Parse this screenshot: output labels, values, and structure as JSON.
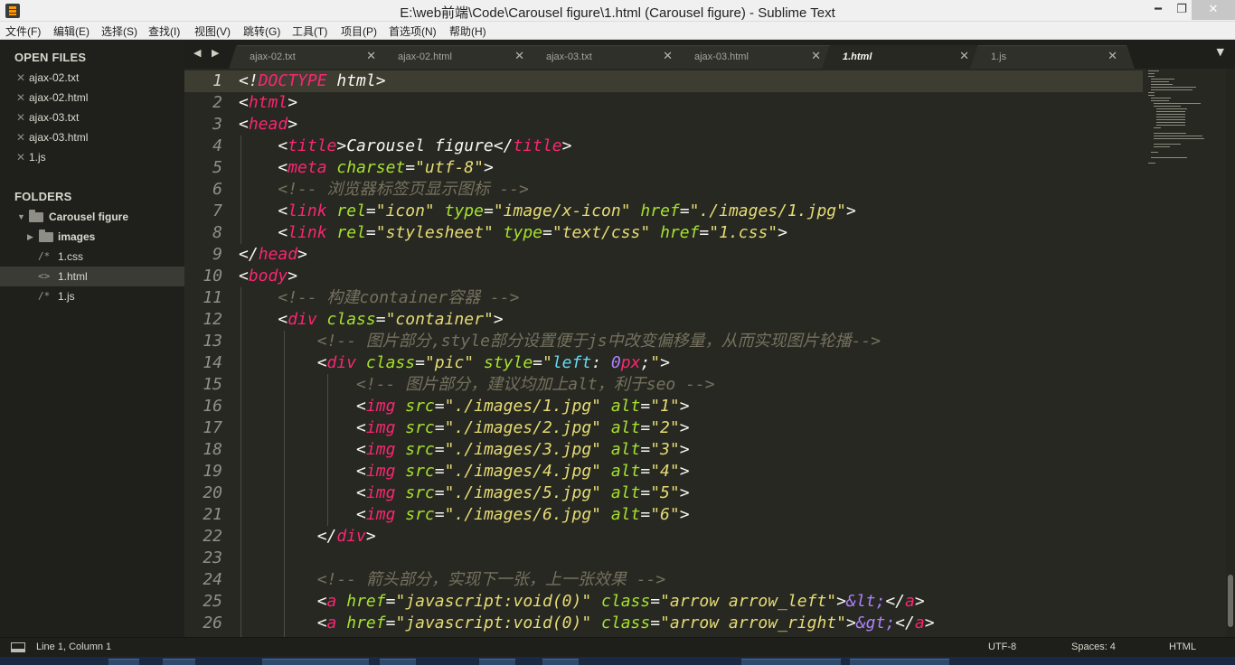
{
  "window": {
    "title": "E:\\web前端\\Code\\Carousel figure\\1.html (Carousel figure) - Sublime Text",
    "min": "━",
    "max": "❐",
    "close": "✕"
  },
  "menu": [
    "文件(F)",
    "编辑(E)",
    "选择(S)",
    "查找(I)",
    "视图(V)",
    "跳转(G)",
    "工具(T)",
    "项目(P)",
    "首选项(N)",
    "帮助(H)"
  ],
  "sidebar": {
    "open_files_label": "OPEN FILES",
    "open_files": [
      "ajax-02.txt",
      "ajax-02.html",
      "ajax-03.txt",
      "ajax-03.html",
      "1.js"
    ],
    "folders_label": "FOLDERS",
    "folders": {
      "root": "Carousel figure",
      "items": [
        {
          "type": "folder",
          "label": "images"
        },
        {
          "type": "file",
          "icon": "/*",
          "label": "1.css"
        },
        {
          "type": "file",
          "icon": "<>",
          "label": "1.html"
        },
        {
          "type": "file",
          "icon": "/*",
          "label": "1.js"
        }
      ]
    }
  },
  "tabs": [
    {
      "label": "ajax-02.txt"
    },
    {
      "label": "ajax-02.html"
    },
    {
      "label": "ajax-03.txt"
    },
    {
      "label": "ajax-03.html"
    },
    {
      "label": "1.html",
      "active": true
    },
    {
      "label": "1.js"
    }
  ],
  "tab_nav": "◀ ▶",
  "tab_close": "✕",
  "tab_dropdown": "▼",
  "editor": {
    "line_numbers": [
      "1",
      "2",
      "3",
      "4",
      "5",
      "6",
      "7",
      "8",
      "9",
      "10",
      "11",
      "12",
      "13",
      "14",
      "15",
      "16",
      "17",
      "18",
      "19",
      "20",
      "21",
      "22",
      "23",
      "24",
      "25",
      "26"
    ],
    "current_line": 1,
    "code_lines": [
      "<!DOCTYPE html>",
      "<html>",
      "<head>",
      "    <title>Carousel figure</title>",
      "    <meta charset=\"utf-8\">",
      "    <!-- 浏览器标签页显示图标 -->",
      "    <link rel=\"icon\" type=\"image/x-icon\" href=\"./images/1.jpg\">",
      "    <link rel=\"stylesheet\" type=\"text/css\" href=\"1.css\">",
      "</head>",
      "<body>",
      "    <!-- 构建container容器 -->",
      "    <div class=\"container\">",
      "        <!-- 图片部分,style部分设置便于js中改变偏移量，从而实现图片轮播-->",
      "        <div class=\"pic\" style=\"left: 0px;\">",
      "            <!-- 图片部分，建议均加上alt，利于seo -->",
      "            <img src=\"./images/1.jpg\" alt=\"1\">",
      "            <img src=\"./images/2.jpg\" alt=\"2\">",
      "            <img src=\"./images/3.jpg\" alt=\"3\">",
      "            <img src=\"./images/4.jpg\" alt=\"4\">",
      "            <img src=\"./images/5.jpg\" alt=\"5\">",
      "            <img src=\"./images/6.jpg\" alt=\"6\">",
      "        </div>",
      "",
      "        <!-- 箭头部分，实现下一张，上一张效果 -->",
      "        <a href=\"javascript:void(0)\" class=\"arrow arrow_left\">&lt;</a>",
      "        <a href=\"javascript:void(0)\" class=\"arrow arrow_right\">&gt;</a>"
    ]
  },
  "status": {
    "position": "Line 1, Column 1",
    "encoding": "UTF-8",
    "indent": "Spaces: 4",
    "syntax": "HTML"
  },
  "colors": {
    "tag": "#f92672",
    "attribute": "#a6e22e",
    "string": "#e6db74",
    "comment": "#75715e",
    "entity": "#ae81ff",
    "css_property": "#66d9ef",
    "background": "#272822"
  }
}
